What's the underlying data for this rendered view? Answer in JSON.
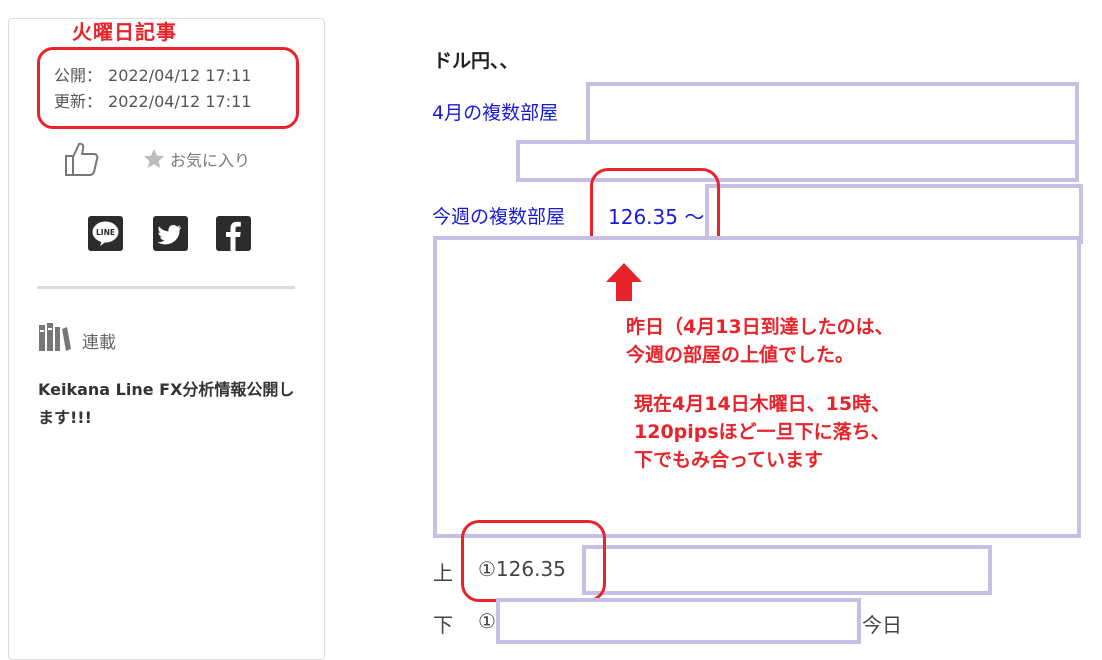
{
  "annotation": {
    "tuesday_article": "火曜日記事",
    "accent_color": "#e8232a",
    "box_color": "#c8bfe7",
    "link_color": "#1a1ad6"
  },
  "sidebar": {
    "published_label": "公開：",
    "published_value": "2022/04/12 17:11",
    "updated_label": "更新：",
    "updated_value": "2022/04/12 17:11",
    "like_icon": "thumbs-up-icon",
    "favorite_icon": "star-icon",
    "favorite_label": "お気に入り",
    "share_icons": [
      "line-icon",
      "twitter-icon",
      "facebook-icon"
    ],
    "series_icon": "books-icon",
    "series_label": "連載",
    "series_title": "Keikana Line FX分析情報公開します!!!"
  },
  "article": {
    "heading": "ドル円、、",
    "april_range_link": "4月の複数部屋",
    "week_range_link": "今週の複数部屋",
    "week_price": "126.35 〜",
    "note_lines": [
      "昨日（4月13日到達したのは、",
      "今週の部屋の上値でした。"
    ],
    "note2_lines": [
      "現在4月14日木曜日、15時、",
      "120pipsほど一旦下に落ち、",
      "下でもみ合っています"
    ],
    "upper_label": "上",
    "upper_value": "①126.35",
    "lower_label": "下",
    "lower_value": "①",
    "today_label": "今日"
  }
}
